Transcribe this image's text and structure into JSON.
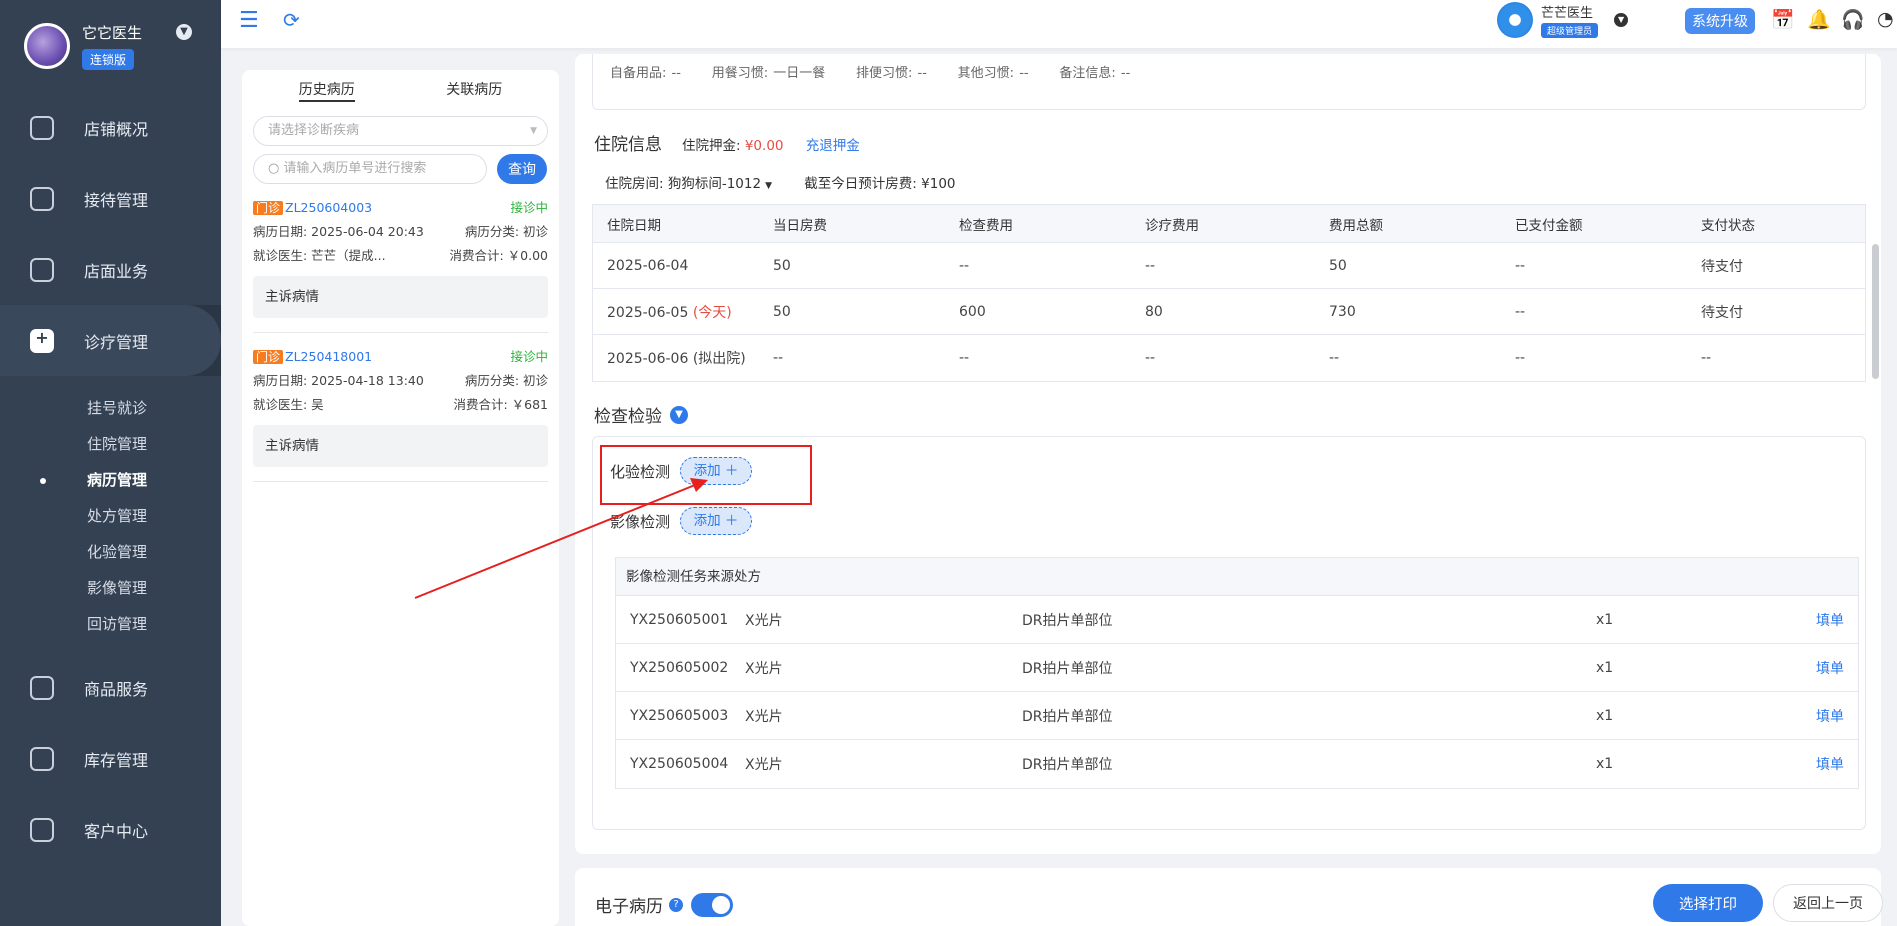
{
  "sidebar": {
    "brand_name": "它它医生",
    "brand_badge": "连锁版",
    "items": [
      {
        "label": "店铺概况"
      },
      {
        "label": "接待管理"
      },
      {
        "label": "店面业务"
      },
      {
        "label": "诊疗管理"
      },
      {
        "label": "商品服务"
      },
      {
        "label": "库存管理"
      },
      {
        "label": "客户中心"
      }
    ],
    "sub_items": [
      {
        "label": "挂号就诊"
      },
      {
        "label": "住院管理"
      },
      {
        "label": "病历管理"
      },
      {
        "label": "处方管理"
      },
      {
        "label": "化验管理"
      },
      {
        "label": "影像管理"
      },
      {
        "label": "回访管理"
      }
    ]
  },
  "topbar": {
    "user_name": "芒芒医生",
    "user_role": "超级管理员",
    "upgrade_label": "系统升级"
  },
  "records": {
    "tabs": [
      {
        "label": "历史病历"
      },
      {
        "label": "关联病历"
      }
    ],
    "disease_placeholder": "请选择诊断疾病",
    "search_placeholder": "请输入病历单号进行搜索",
    "query_label": "查询",
    "list": [
      {
        "tag": "门诊",
        "no": "ZL250604003",
        "status": "接诊中",
        "date": "病历日期: 2025-06-04 20:43",
        "category": "病历分类: 初诊",
        "doctor": "就诊医生: 芒芒（提成...",
        "total": "消费合计: ￥0.00",
        "complaint": "主诉病情"
      },
      {
        "tag": "门诊",
        "no": "ZL250418001",
        "status": "接诊中",
        "date": "病历日期: 2025-04-18 13:40",
        "category": "病历分类: 初诊",
        "doctor": "就诊医生: 吴",
        "total": "消费合计: ￥681",
        "complaint": "主诉病情"
      }
    ]
  },
  "habits": {
    "text": "自备用品: --      用餐习惯: 一日一餐      排便习惯: --      其他习惯: --      备注信息: --"
  },
  "hospital": {
    "title": "住院信息",
    "deposit_label": "住院押金: ",
    "deposit_amount": "¥0.00",
    "deposit_link": "充退押金",
    "room_label": "住院房间: 狗狗标间-1012",
    "fee_label": "截至今日预计房费: ¥100",
    "columns": [
      "住院日期",
      "当日房费",
      "检查费用",
      "诊疗费用",
      "费用总额",
      "已支付金额",
      "支付状态"
    ],
    "rows": [
      {
        "date": "2025-06-04",
        "note": "",
        "room": "50",
        "check": "--",
        "treat": "--",
        "total": "50",
        "paid": "--",
        "status": "待支付"
      },
      {
        "date": "2025-06-05",
        "note": "(今天)",
        "room": "50",
        "check": "600",
        "treat": "80",
        "total": "730",
        "paid": "--",
        "status": "待支付"
      },
      {
        "date": "2025-06-06",
        "note": "(拟出院)",
        "room": "--",
        "check": "--",
        "treat": "--",
        "total": "--",
        "paid": "--",
        "status": "--"
      }
    ]
  },
  "exam": {
    "title": "检查检验",
    "lab_label": "化验检测",
    "imaging_label": "影像检测",
    "add_label": "添加 ＋",
    "imaging_header": "影像检测任务来源处方",
    "imaging_rows": [
      {
        "no": "YX250605001",
        "type": "X光片",
        "item": "DR拍片单部位",
        "qty": "x1",
        "action": "填单"
      },
      {
        "no": "YX250605002",
        "type": "X光片",
        "item": "DR拍片单部位",
        "qty": "x1",
        "action": "填单"
      },
      {
        "no": "YX250605003",
        "type": "X光片",
        "item": "DR拍片单部位",
        "qty": "x1",
        "action": "填单"
      },
      {
        "no": "YX250605004",
        "type": "X光片",
        "item": "DR拍片单部位",
        "qty": "x1",
        "action": "填单"
      }
    ]
  },
  "emr": {
    "title": "电子病历",
    "print_label": "选择打印",
    "back_label": "返回上一页"
  },
  "colors": {
    "primary": "#2f79e9",
    "sidebar": "#344152",
    "highlight": "#e5201f",
    "danger": "#e54d42",
    "success": "#2bb33b",
    "tag": "#f77b1f"
  }
}
